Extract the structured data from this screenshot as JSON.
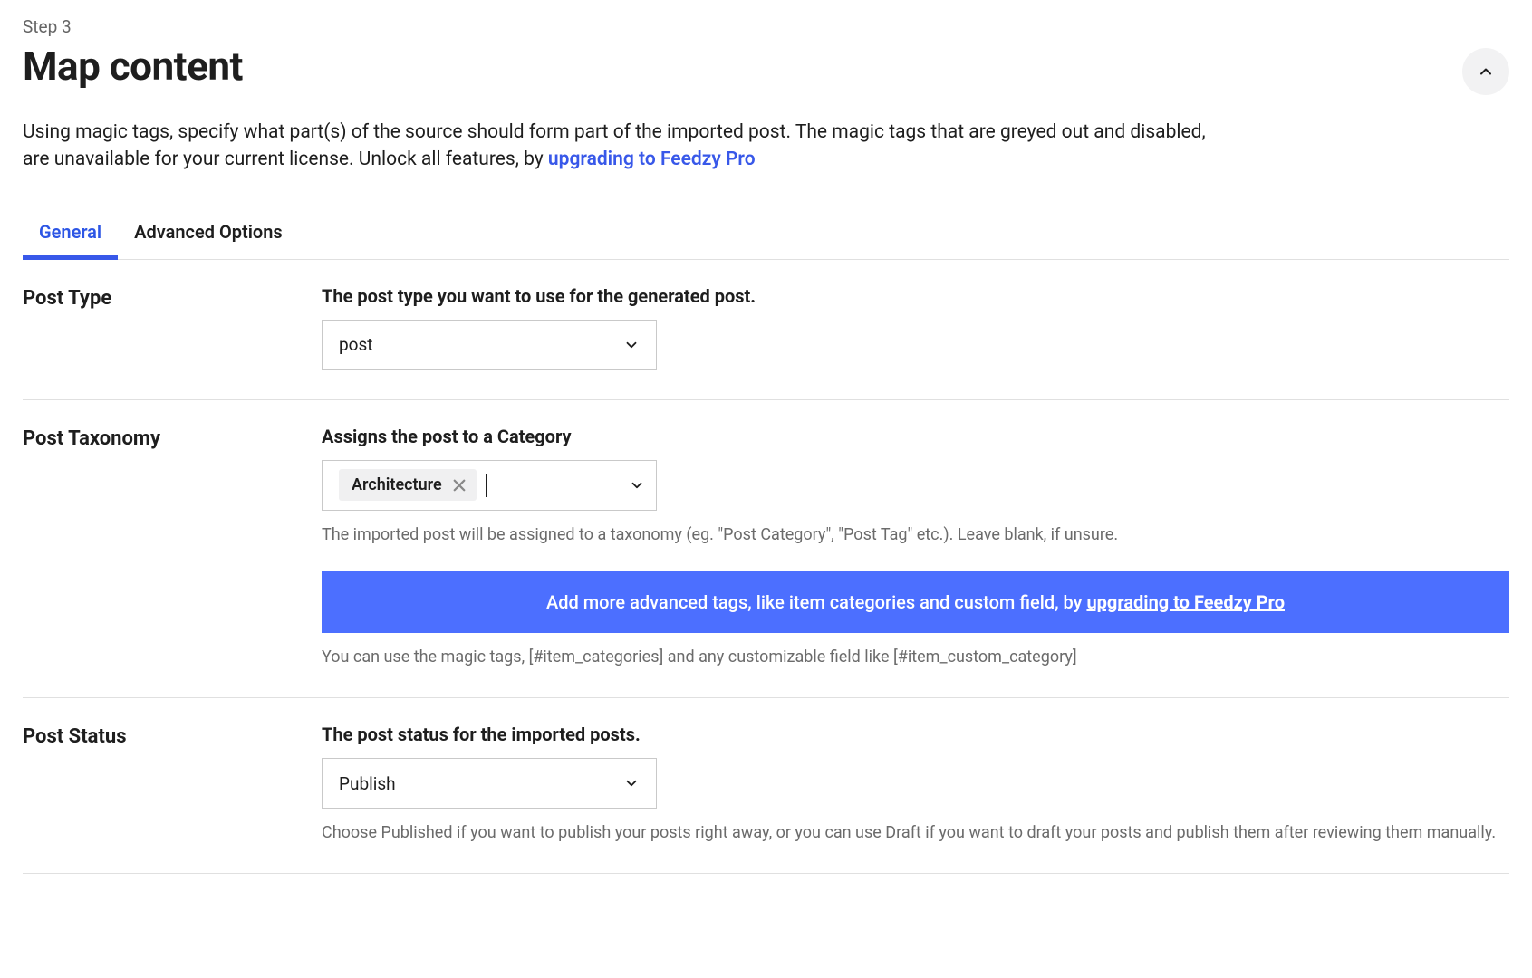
{
  "step_label": "Step 3",
  "title": "Map content",
  "intro_text": "Using magic tags, specify what part(s) of the source should form part of the imported post. The magic tags that are greyed out and disabled, are unavailable for your current license. Unlock all features, by ",
  "intro_link": "upgrading to Feedzy Pro",
  "tabs": {
    "general": "General",
    "advanced": "Advanced Options"
  },
  "post_type": {
    "label": "Post Type",
    "desc": "The post type you want to use for the generated post.",
    "value": "post"
  },
  "taxonomy": {
    "label": "Post Taxonomy",
    "desc": "Assigns the post to a Category",
    "chip": "Architecture",
    "help": "The imported post will be assigned to a taxonomy (eg. \"Post Category\", \"Post Tag\" etc.). Leave blank, if unsure.",
    "banner_prefix": "Add more advanced tags, like item categories and custom field, by ",
    "banner_link": "upgrading to Feedzy Pro",
    "magic_help": "You can use the magic tags, [#item_categories] and any customizable field like [#item_custom_category]"
  },
  "status": {
    "label": "Post Status",
    "desc": "The post status for the imported posts.",
    "value": "Publish",
    "help": "Choose Published if you want to publish your posts right away, or you can use Draft if you want to draft your posts and publish them after reviewing them manually."
  }
}
